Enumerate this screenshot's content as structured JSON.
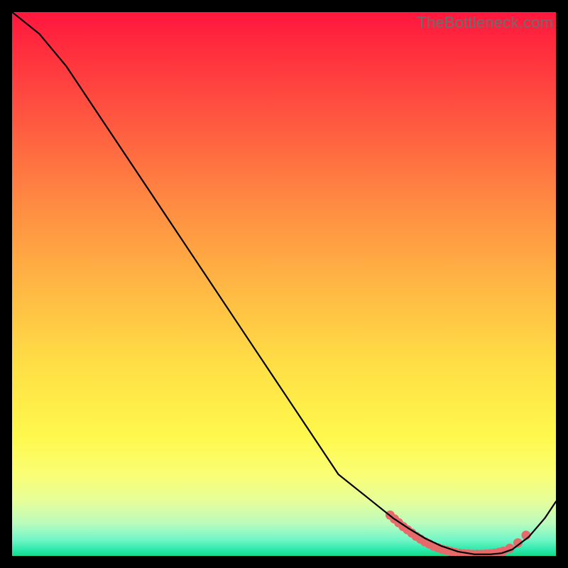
{
  "watermark": "TheBottleneck.com",
  "chart_data": {
    "type": "line",
    "title": "",
    "xlabel": "",
    "ylabel": "",
    "xlim": [
      0,
      100
    ],
    "ylim": [
      0,
      100
    ],
    "series": [
      {
        "name": "curve",
        "x": [
          0,
          5,
          10,
          15,
          20,
          25,
          30,
          35,
          40,
          45,
          50,
          55,
          60,
          65,
          70,
          73,
          76,
          79,
          82,
          85,
          88,
          90,
          92,
          95,
          98,
          100
        ],
        "y": [
          100,
          96,
          90,
          82.5,
          75,
          67.5,
          60,
          52.5,
          45,
          37.5,
          30,
          22.5,
          15,
          11,
          7,
          5,
          3.2,
          1.8,
          0.8,
          0.3,
          0.3,
          0.5,
          1.2,
          3.5,
          7,
          10
        ]
      }
    ],
    "markers": {
      "name": "highlight-dots",
      "color": "#e66a6a",
      "x": [
        69.5,
        70.3,
        71.1,
        71.9,
        72.7,
        73.5,
        74.3,
        75.1,
        75.9,
        76.7,
        77.5,
        78.3,
        79.1,
        79.9,
        80.7,
        81.5,
        82.3,
        83.1,
        83.9,
        84.7,
        85.5,
        86.3,
        87.1,
        87.9,
        88.7,
        89.5,
        90.3,
        91.5,
        93.0,
        94.5
      ],
      "y": [
        7.5,
        6.8,
        6.1,
        5.4,
        4.8,
        4.2,
        3.6,
        3.1,
        2.6,
        2.2,
        1.8,
        1.5,
        1.2,
        1.0,
        0.8,
        0.6,
        0.5,
        0.4,
        0.35,
        0.3,
        0.3,
        0.3,
        0.35,
        0.4,
        0.5,
        0.65,
        0.85,
        1.4,
        2.4,
        3.8
      ]
    }
  }
}
